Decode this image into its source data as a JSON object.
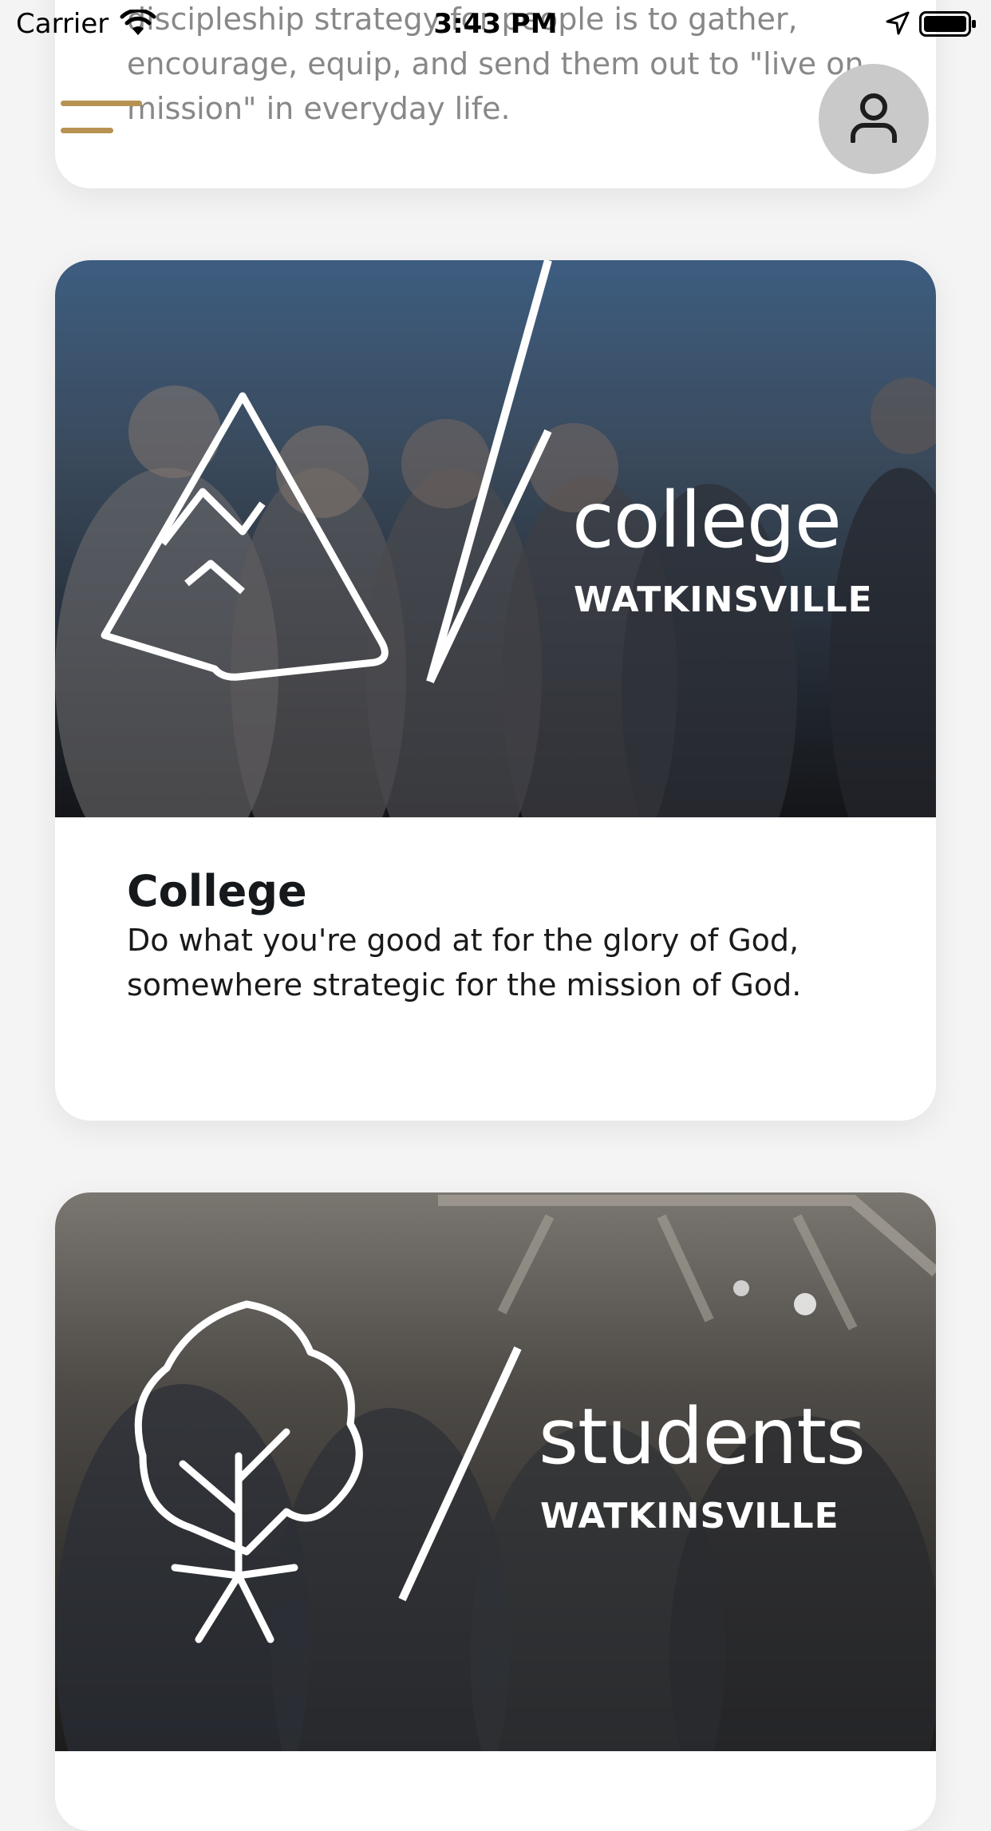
{
  "status_bar": {
    "carrier": "Carrier",
    "time": "3:43 PM"
  },
  "icons": {
    "menu": "hamburger-menu-icon",
    "profile": "user-icon",
    "wifi": "wifi-icon",
    "location": "location-arrow-icon",
    "battery": "battery-icon"
  },
  "colors": {
    "accent": "#b89253",
    "background": "#f4f4f4",
    "card": "#ffffff",
    "profile_button": "#c9c9c9"
  },
  "cards": [
    {
      "id": "top-partial",
      "description": "discipleship strategy for people is to gather, encourage, equip, and send them out to \"live on mission\" in everyday life."
    },
    {
      "id": "college",
      "hero_word": "college",
      "hero_sub": "WATKINSVILLE",
      "title": "College",
      "description": "Do what you're good at for the glory of God, somewhere strategic for the mission of God."
    },
    {
      "id": "students",
      "hero_word": "students",
      "hero_sub": "WATKINSVILLE"
    }
  ]
}
